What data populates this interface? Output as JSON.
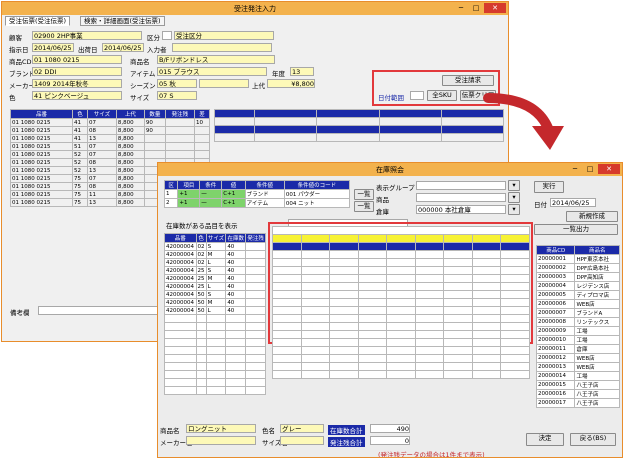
{
  "back_window": {
    "title": "受注発注入力",
    "tabs": [
      "受注伝票(受注伝票)",
      "検索・詳細画面(受注伝票)"
    ],
    "fields": {
      "customer_label": "顧客",
      "customer_value": "02900 2HP事業",
      "order_type_label": "区分",
      "order_type_value": "受注区分",
      "order_date_label": "指示日",
      "order_date_value": "2014/06/25",
      "ship_date_label": "出荷日",
      "ship_date_value": "2014/06/25",
      "entry_label": "入力者",
      "product_code_label": "商品CD",
      "product_code_value": "01 1080 0215",
      "product_name_label": "商品名",
      "product_name_value": "B/Fリボンドレス",
      "brand_label": "ブランド",
      "brand_value": "02 DDI",
      "item_label": "アイテム",
      "item_value": "015 ブラウス",
      "year_label": "年度",
      "year_value": "13",
      "maker_label": "メーカー",
      "maker_value": "1409 2014年秋冬",
      "season_label": "シーズン",
      "season_value": "05 秋",
      "retail_label": "上代",
      "retail_value": "¥8,800",
      "color_label": "色",
      "color_value": "41 ピンクベージュ",
      "size_label": "サイズ",
      "size_value": "07 S",
      "memo_label": "備考欄"
    },
    "buttons": {
      "issue": "受注請求",
      "all": "全SKU",
      "clear": "伝票クリア"
    },
    "filter_label": "日付範囲",
    "table_headers": [
      "品番",
      "色",
      "サイズ",
      "上代",
      "数量",
      "発注残",
      "差"
    ],
    "rows": [
      [
        "01 1080 0215",
        "41",
        "07",
        "8,800",
        "90",
        "",
        "10"
      ],
      [
        "01 1080 0215",
        "41",
        "08",
        "8,800",
        "90",
        "",
        ""
      ],
      [
        "01 1080 0215",
        "41",
        "13",
        "8,800",
        "",
        "",
        ""
      ],
      [
        "01 1080 0215",
        "51",
        "07",
        "8,800",
        "",
        "",
        ""
      ],
      [
        "01 1080 0215",
        "52",
        "07",
        "8,800",
        "",
        "",
        ""
      ],
      [
        "01 1080 0215",
        "52",
        "08",
        "8,800",
        "",
        "",
        ""
      ],
      [
        "01 1080 0215",
        "52",
        "13",
        "8,800",
        "",
        "",
        ""
      ],
      [
        "01 1080 0215",
        "75",
        "07",
        "8,800",
        "",
        "",
        ""
      ],
      [
        "01 1080 0215",
        "75",
        "08",
        "8,800",
        "",
        "",
        ""
      ],
      [
        "01 1080 0215",
        "75",
        "11",
        "8,800",
        "",
        "",
        ""
      ],
      [
        "01 1080 0215",
        "75",
        "13",
        "8,800",
        "",
        "",
        ""
      ]
    ]
  },
  "front_window": {
    "title": "在庫照会",
    "filter_headers": [
      "区",
      "項目",
      "条件",
      "値",
      "条件値",
      "条件値のコード"
    ],
    "filter_rows": [
      [
        "1",
        "+1",
        "一",
        "C+1",
        "ブランド",
        "001 パウダー"
      ],
      [
        "2",
        "+1",
        "一",
        "C+1",
        "アイテム",
        "004 ニット"
      ]
    ],
    "list_btn": "一覧",
    "display_group_label": "表示グループ",
    "product_label": "商品",
    "warehouse_label": "倉庫",
    "warehouse_value": "000000 本社倉庫",
    "run_button": "実行",
    "date_label": "日付",
    "date_value": "2014/06/25",
    "new_button": "新規作成",
    "export_button": "一覧出力",
    "section_label": "在庫数がある品目を表示",
    "total_label": "合計",
    "table_headers": [
      "品番",
      "色",
      "サイズ",
      "在庫数",
      "発注残"
    ],
    "rows": [
      [
        "42000004",
        "02",
        "S",
        "40"
      ],
      [
        "42000004",
        "02",
        "M",
        "40"
      ],
      [
        "42000004",
        "02",
        "L",
        "40"
      ],
      [
        "42000004",
        "25",
        "S",
        "40"
      ],
      [
        "42000004",
        "25",
        "M",
        "40"
      ],
      [
        "42000004",
        "25",
        "L",
        "40"
      ],
      [
        "42000004",
        "50",
        "S",
        "40"
      ],
      [
        "42000004",
        "50",
        "M",
        "40"
      ],
      [
        "42000004",
        "50",
        "L",
        "40"
      ]
    ],
    "right_list_headers": [
      "商品CD",
      "商品名"
    ],
    "right_list": [
      [
        "20000001",
        "HPF東京本社"
      ],
      [
        "20000002",
        "DPF広島本社"
      ],
      [
        "20000003",
        "DPF高知店"
      ],
      [
        "20000004",
        "レジデンス店"
      ],
      [
        "20000005",
        "ディプロマ店"
      ],
      [
        "20000006",
        "WEB店"
      ],
      [
        "20000007",
        "ブランドA"
      ],
      [
        "20000008",
        "リンテックス"
      ],
      [
        "20000009",
        "工場"
      ],
      [
        "20000010",
        "工場"
      ],
      [
        "20000011",
        "倉庫"
      ],
      [
        "20000012",
        "WEB店"
      ],
      [
        "20000013",
        "WEB店"
      ],
      [
        "20000014",
        "工場"
      ],
      [
        "20000015",
        "八王子店"
      ],
      [
        "20000016",
        "八王子店"
      ],
      [
        "20000017",
        "八王子店"
      ]
    ],
    "bottom": {
      "product_name_label": "商品名",
      "product_name_value": "ロングニット",
      "color_label": "色名",
      "color_value": "グレー",
      "maker_label": "メーカー名",
      "size_label": "サイズ名",
      "stock_total_label": "在庫数合計",
      "stock_total_value": "490",
      "order_total_label": "発注残合計",
      "order_total_value": "0",
      "note": "(発注残データの場合は1件まで表示)",
      "decide_button": "決定",
      "cancel_button": "戻る(BS)"
    }
  }
}
